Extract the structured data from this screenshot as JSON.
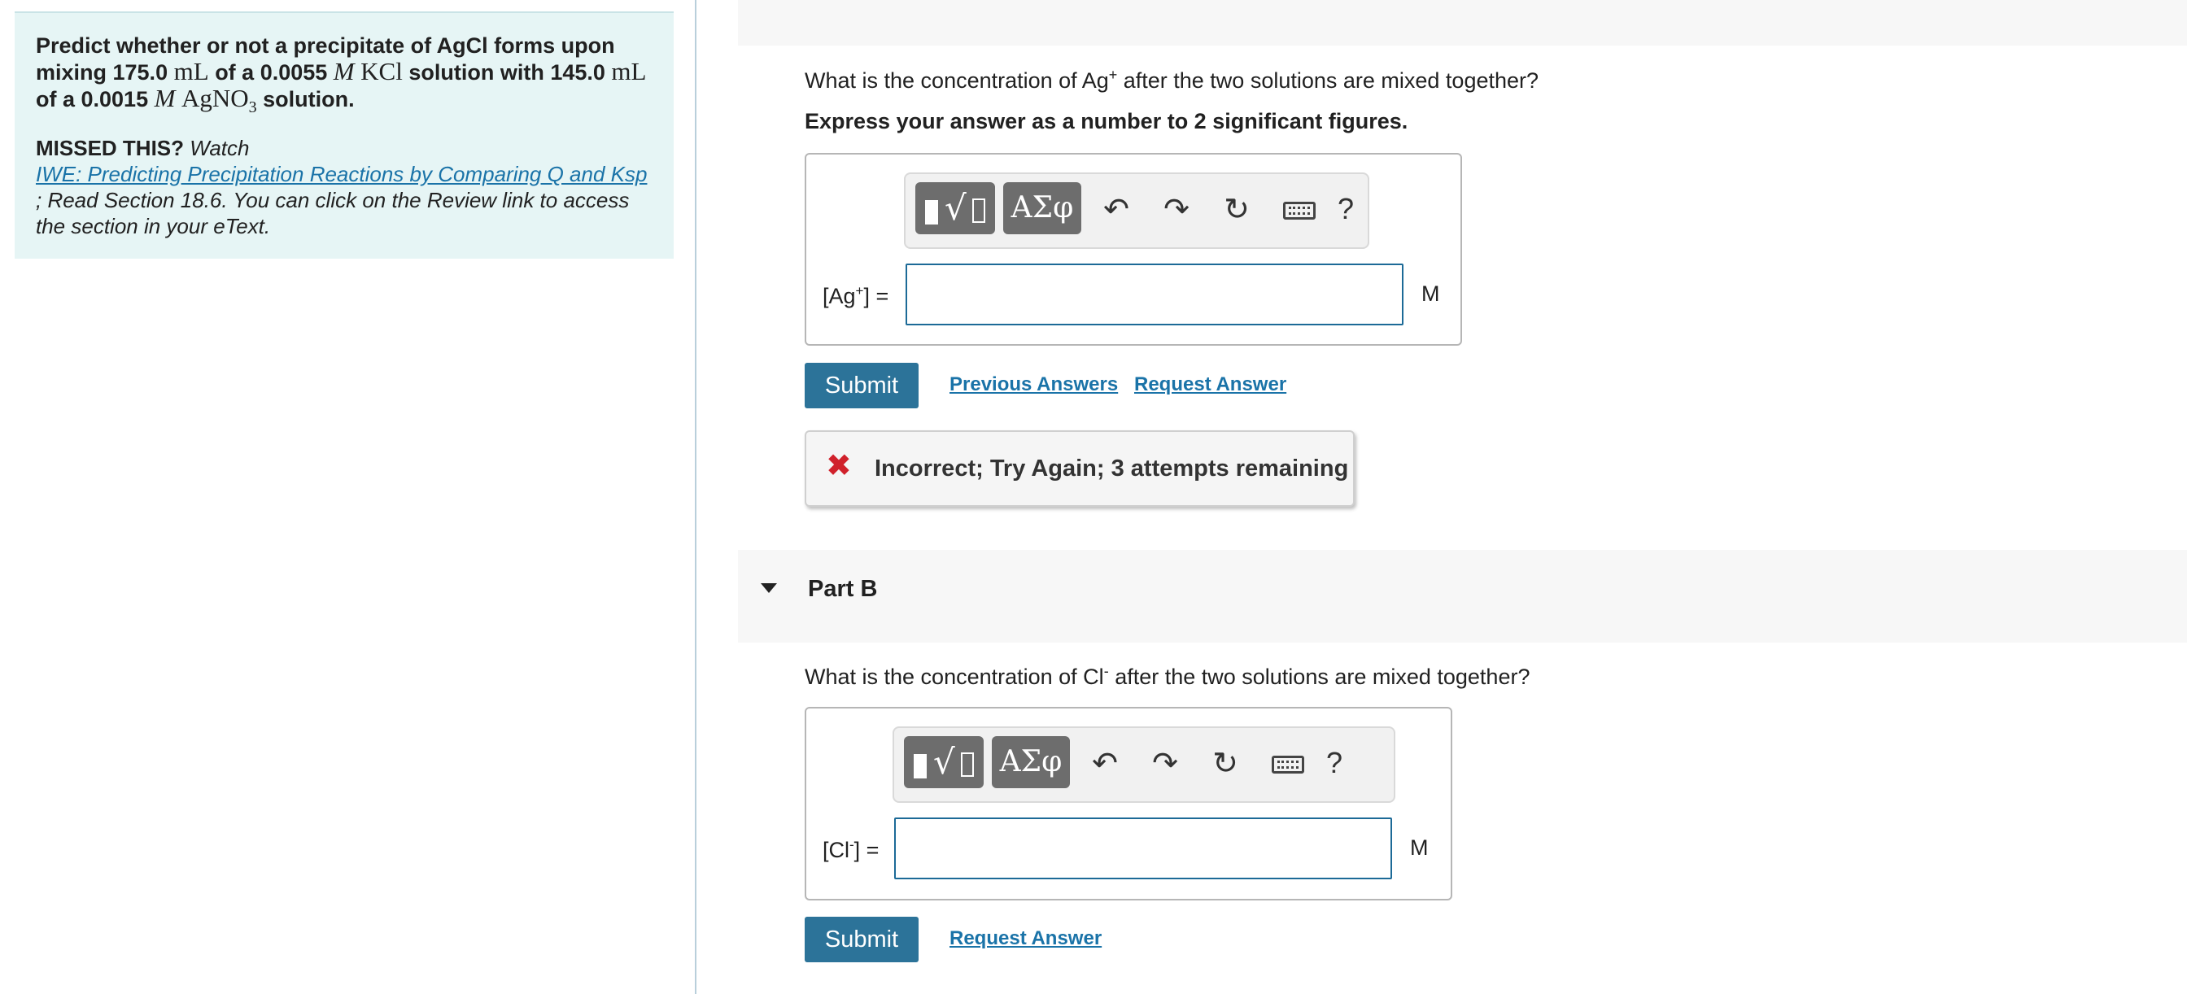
{
  "problem": {
    "text_1": "Predict whether or not a precipitate of AgCl forms upon mixing 175.0",
    "unit_ml_1": "mL",
    "text_2": "of a 0.0055",
    "molar_1": "M",
    "kcl": "KCl",
    "text_3": "solution with 145.0",
    "unit_ml_2": "mL",
    "text_4": "of a 0.0015",
    "molar_2": "M",
    "agno": "AgNO",
    "agno_sub": "3",
    "text_5": "solution.",
    "missed_label": "MISSED THIS?",
    "missed_watch": "Watch",
    "missed_link": "IWE: Predicting Precipitation Reactions by Comparing Q and Ksp",
    "missed_rest": "; Read Section 18.6. You can click on the Review link to access the section in your eText."
  },
  "part_a": {
    "question_pre": "What is the concentration of Ag",
    "question_sup": "+",
    "question_post": " after the two solutions are mixed together?",
    "instruction": "Express your answer as a number to 2 significant figures.",
    "label_pre": "[Ag",
    "label_sup": "+",
    "label_post": "] =",
    "input_value": "",
    "unit": "M",
    "submit_label": "Submit",
    "previous_answers_label": "Previous Answers",
    "request_answer_label": "Request Answer",
    "feedback_text": "Incorrect; Try Again; 3 attempts remaining"
  },
  "part_b": {
    "title": "Part B",
    "question_pre": "What is the concentration of Cl",
    "question_sup": "-",
    "question_post": " after the two solutions are mixed together?",
    "label_pre": "[Cl",
    "label_sup": "-",
    "label_post": "] =",
    "input_value": "",
    "unit": "M",
    "submit_label": "Submit",
    "request_answer_label": "Request Answer"
  },
  "toolbar": {
    "symbols_label": "ΑΣφ",
    "undo_icon": "↶",
    "redo_icon": "↷",
    "reset_icon": "↻",
    "help_label": "?"
  },
  "colors": {
    "problem_bg": "#e6f5f5",
    "link": "#1a73a8",
    "submit_bg": "#2c7399",
    "input_border": "#1c6a97",
    "error_icon": "#d0212b"
  }
}
